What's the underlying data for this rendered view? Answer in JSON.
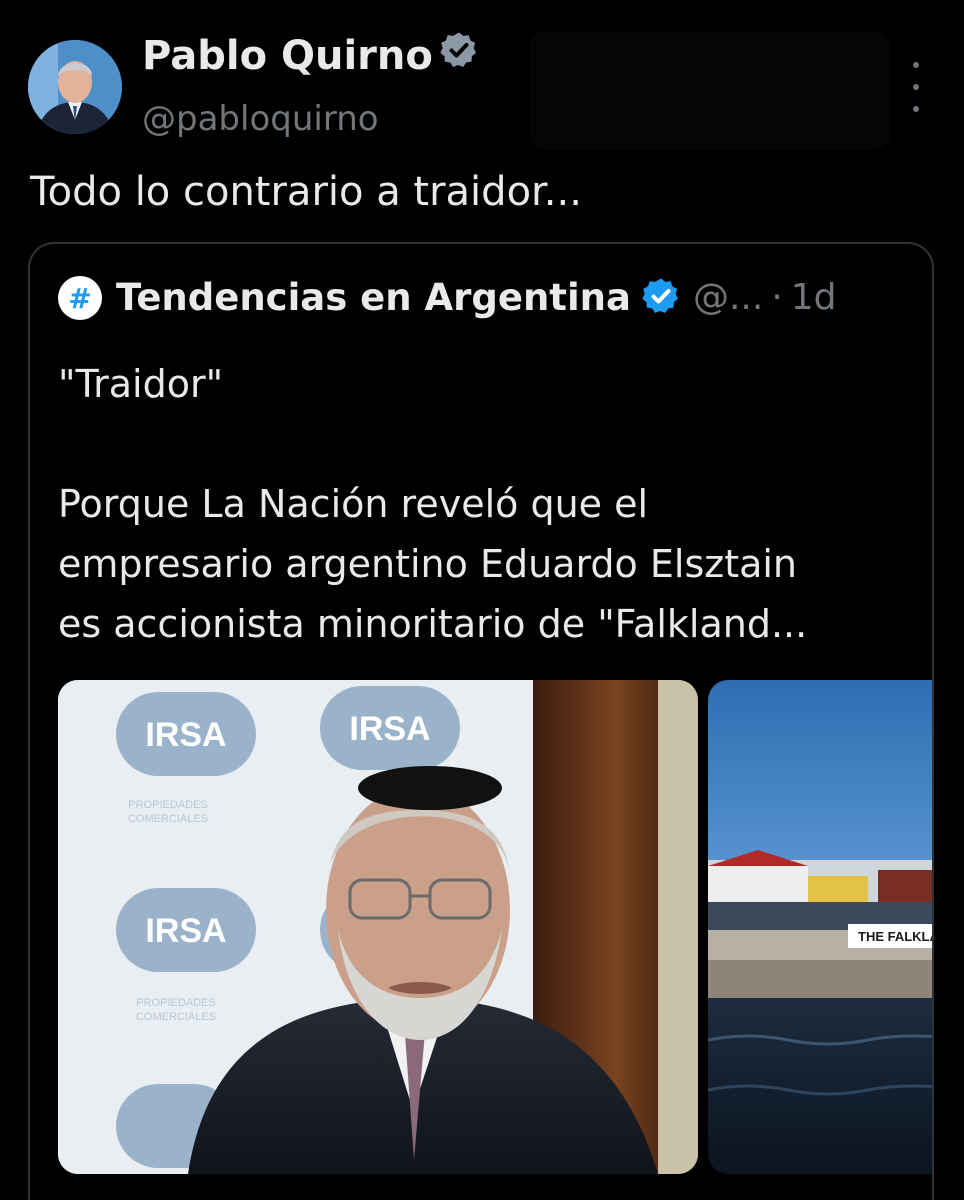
{
  "author": {
    "name": "Pablo Quirno",
    "handle": "@pabloquirno",
    "verified": true
  },
  "tweet": {
    "text": "Todo lo contrario a traidor..."
  },
  "quoted_tweet": {
    "icon": "hashtag-icon",
    "name": "Tendencias en Argentina",
    "verified": true,
    "handle": "@...",
    "separator": "·",
    "time": "1d",
    "lines": [
      "\"Traidor\"",
      "",
      "Porque La Nación reveló que el",
      "empresario argentino Eduardo Elsztain",
      "es accionista minoritario de \"Falkland..."
    ],
    "media": [
      {
        "logo_text": "IRSA",
        "logo_subtext_1": "PROPIEDADES",
        "logo_subtext_2": "COMERCIALES"
      },
      {
        "sign_text": "THE FALKLAND"
      }
    ]
  },
  "colors": {
    "background": "#000000",
    "text": "#e7e9ea",
    "secondary": "#71767b",
    "verified": "#1d9bf0",
    "border": "#2f3336"
  }
}
